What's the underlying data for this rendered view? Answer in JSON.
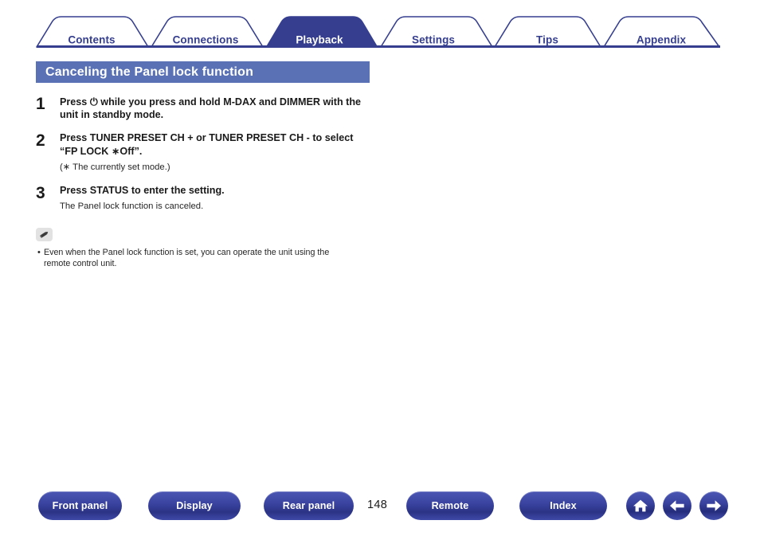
{
  "tabs": [
    {
      "label": "Contents",
      "active": false
    },
    {
      "label": "Connections",
      "active": false
    },
    {
      "label": "Playback",
      "active": true
    },
    {
      "label": "Settings",
      "active": false
    },
    {
      "label": "Tips",
      "active": false
    },
    {
      "label": "Appendix",
      "active": false
    }
  ],
  "section": {
    "title": "Canceling the Panel lock function"
  },
  "steps": [
    {
      "number": "1",
      "title_pre": "Press ",
      "power_glyph": "⏻",
      "title_post": " while you press and hold M-DAX and DIMMER with the unit in standby mode.",
      "sub": ""
    },
    {
      "number": "2",
      "title_pre": "Press TUNER PRESET CH + or TUNER PRESET CH - to select “FP LOCK ",
      "power_glyph": "∗",
      "title_post": "Off”.",
      "sub_pre": "(",
      "sub_ast": "∗",
      "sub_post": " The currently set mode.)"
    },
    {
      "number": "3",
      "title": "Press STATUS to enter the setting.",
      "sub": "The Panel lock function is canceled."
    }
  ],
  "note": {
    "icon": "pencil-icon",
    "bullet": "•",
    "text": "Even when the Panel lock function is set, you can operate the unit using the remote control unit."
  },
  "footer": {
    "buttons": [
      {
        "label": "Front panel"
      },
      {
        "label": "Display"
      },
      {
        "label": "Rear panel"
      },
      {
        "label": "Remote"
      },
      {
        "label": "Index"
      }
    ],
    "page_number": "148",
    "nav": [
      {
        "icon": "home-icon"
      },
      {
        "icon": "arrow-left-icon"
      },
      {
        "icon": "arrow-right-icon"
      }
    ]
  },
  "colors": {
    "tab_blue": "#363f8f",
    "header_blue": "#5a72b5",
    "button_blue": "#3a44a0",
    "text": "#1a1a1a"
  }
}
